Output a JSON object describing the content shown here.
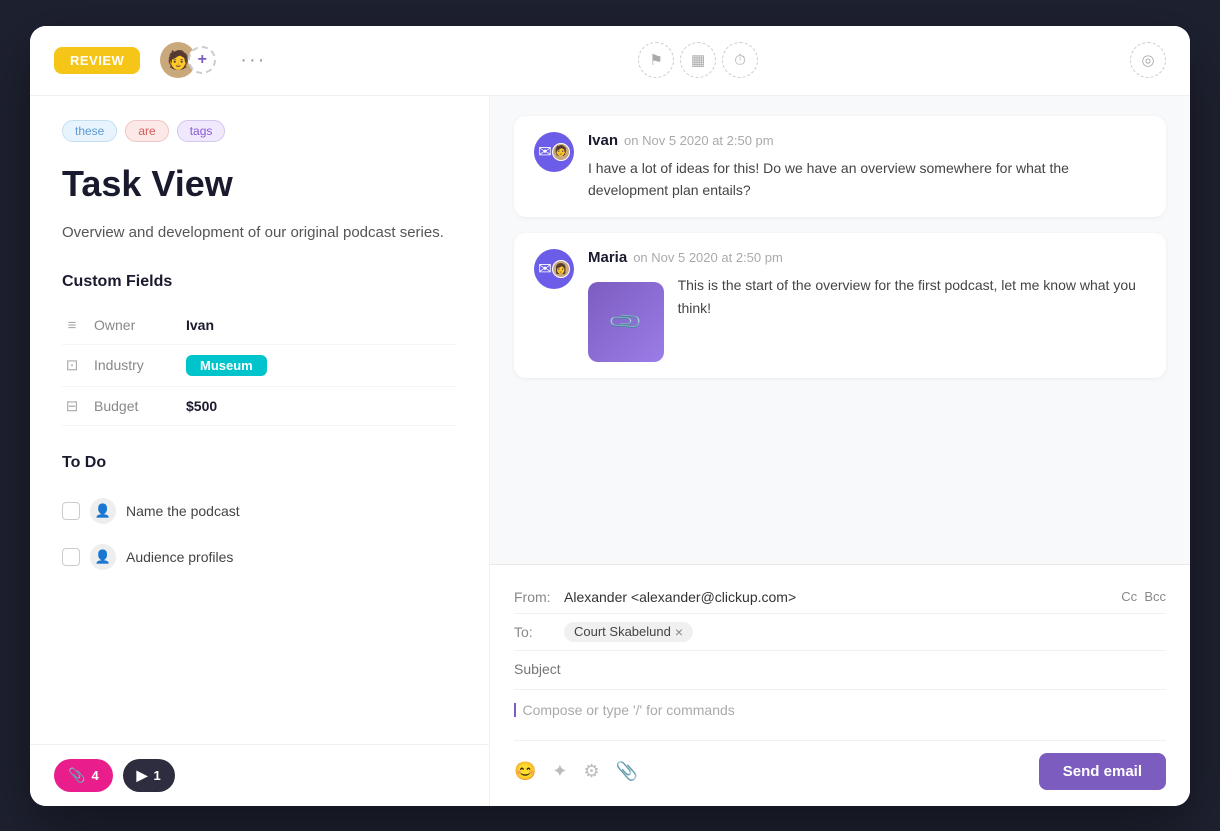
{
  "window": {
    "background": "#1e2130"
  },
  "toolbar": {
    "review_label": "REVIEW",
    "more_btn_label": "···",
    "add_icon": "+",
    "flag_icon": "⚑",
    "calendar_icon": "▦",
    "clock_icon": "⏱",
    "eye_icon": "◎"
  },
  "tags": [
    {
      "label": "these",
      "class": "tag-these"
    },
    {
      "label": "are",
      "class": "tag-are"
    },
    {
      "label": "tags",
      "class": "tag-tags"
    }
  ],
  "task": {
    "title": "Task View",
    "description": "Overview and development of our original podcast series."
  },
  "custom_fields": {
    "section_title": "Custom Fields",
    "fields": [
      {
        "icon": "≡",
        "label": "Owner",
        "value": "Ivan",
        "type": "text"
      },
      {
        "icon": "⊡",
        "label": "Industry",
        "value": "Museum",
        "type": "badge"
      },
      {
        "icon": "⊟",
        "label": "Budget",
        "value": "$500",
        "type": "text"
      }
    ]
  },
  "todo": {
    "section_title": "To Do",
    "items": [
      {
        "label": "Name the podcast"
      },
      {
        "label": "Audience profiles"
      }
    ]
  },
  "footer_badges": [
    {
      "icon": "🔴",
      "count": "4",
      "color": "pink"
    },
    {
      "icon": "F",
      "count": "1",
      "color": "dark"
    }
  ],
  "comments": [
    {
      "author": "Ivan",
      "time": "on Nov 5 2020 at 2:50 pm",
      "text": "I have a lot of ideas for this! Do we have an overview somewhere for what the development plan entails?",
      "has_attachment": false
    },
    {
      "author": "Maria",
      "time": "on Nov 5 2020 at 2:50 pm",
      "text": "This is the start of the overview for the first podcast, let me know what you think!",
      "has_attachment": true
    }
  ],
  "email_compose": {
    "from_label": "From:",
    "from_value": "Alexander <alexander@clickup.com>",
    "cc_label": "Cc",
    "bcc_label": "Bcc",
    "to_label": "To:",
    "to_recipient": "Court Skabelund",
    "subject_placeholder": "Subject",
    "compose_placeholder": "Compose or type '/' for commands",
    "send_label": "Send email"
  }
}
